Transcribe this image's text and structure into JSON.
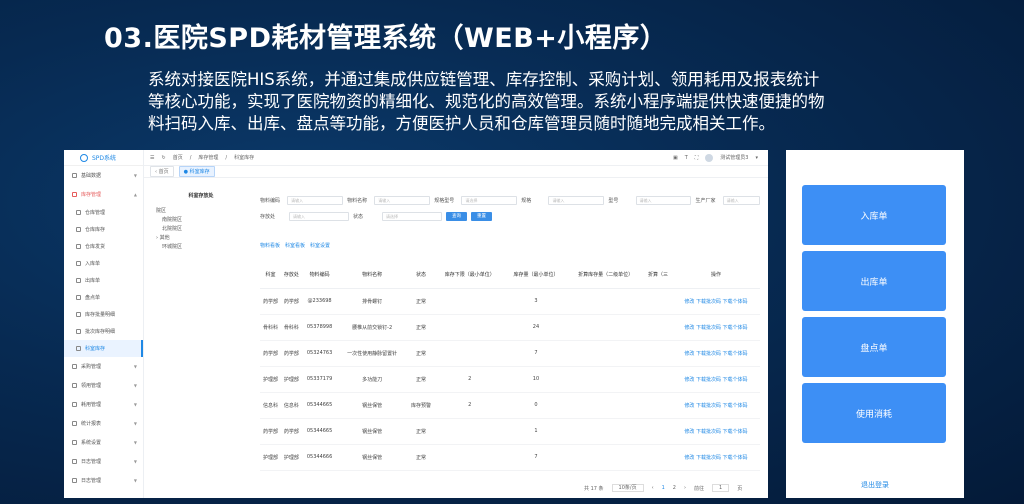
{
  "slide": {
    "title": "03.医院SPD耗材管理系统（WEB+小程序）",
    "desc_lines": [
      "系统对接医院HIS系统，并通过集成供应链管理、库存控制、采购计划、领用耗用及报表统计",
      "等核心功能，实现了医院物资的精细化、规范化的高效管理。系统小程序端提供快速便捷的物",
      "料扫码入库、出库、盘点等功能，方便医护人员和仓库管理员随时随地完成相关工作。"
    ]
  },
  "web": {
    "logo": "SPD系统",
    "menu": [
      "基础数据",
      "库存管理",
      "仓库管理",
      "仓库库存",
      "仓库发货",
      "入库单",
      "出库单",
      "盘点单",
      "库存批量明细",
      "批次库存明细",
      "科室库存",
      "采购管理",
      "领用管理",
      "耗用管理",
      "统计报表",
      "系统设置",
      "日志管理",
      "日志管理"
    ],
    "topbar": {
      "home": "首页",
      "crumb1": "库存管理",
      "crumb2": "科室库存",
      "user": "测试管理员3"
    },
    "tabs": {
      "back": "首页",
      "current": "科室库存"
    },
    "tree": {
      "title": "科室存放处",
      "nodes": [
        "院区",
        "南院院区",
        "北院院区",
        "其他",
        "环城院区"
      ]
    },
    "filters": {
      "row1": [
        {
          "label": "物料编码",
          "ph": "请输入"
        },
        {
          "label": "物料名称",
          "ph": "请输入"
        },
        {
          "label": "规格型号",
          "ph": "请选择"
        },
        {
          "label": "规格",
          "ph": "请输入"
        },
        {
          "label": "型号",
          "ph": "请输入"
        },
        {
          "label": "生产厂家",
          "ph": "请输入"
        }
      ],
      "row2": [
        {
          "label": "存放处",
          "ph": "请输入"
        },
        {
          "label": "状态",
          "ph": "请选择"
        }
      ],
      "search": "查询",
      "reset": "重置",
      "links": [
        "物料看板",
        "科室看板",
        "科室设置"
      ]
    },
    "table": {
      "headers": [
        "",
        "科室",
        "存放处",
        "物料编码",
        "物料名称",
        "状态",
        "库存下限（最小单位）",
        "库存量（最小单位）",
        "折算库存量（二级单位）",
        "折算（三",
        "操作"
      ],
      "rows": [
        [
          "",
          "药学部",
          "药学部",
          "@233698",
          "排骨螺钉",
          "正常",
          "",
          "3",
          "",
          "",
          "修改 下载批次码 下载个体码"
        ],
        [
          "",
          "骨科科",
          "骨科科",
          "05378998",
          "腰椎从前交锁钉-2",
          "正常",
          "",
          "24",
          "",
          "",
          "修改 下载批次码 下载个体码"
        ],
        [
          "",
          "药学部",
          "药学部",
          "05324763",
          "一次性使用静脉留置针",
          "正常",
          "",
          "7",
          "",
          "",
          "修改 下载批次码 下载个体码"
        ],
        [
          "",
          "护理部",
          "护理部",
          "05337179",
          "多功能刀",
          "正常",
          "2",
          "10",
          "",
          "",
          "修改 下载批次码 下载个体码"
        ],
        [
          "",
          "信息科",
          "信息科",
          "05344665",
          "钢丝保管",
          "库存预警",
          "2",
          "0",
          "",
          "",
          "修改 下载批次码 下载个体码"
        ],
        [
          "",
          "药学部",
          "药学部",
          "05344665",
          "钢丝保管",
          "正常",
          "",
          "1",
          "",
          "",
          "修改 下载批次码 下载个体码"
        ],
        [
          "",
          "护理部",
          "护理部",
          "05344666",
          "钢丝保管",
          "正常",
          "",
          "7",
          "",
          "",
          "修改 下载批次码 下载个体码"
        ]
      ]
    },
    "pager": {
      "total": "共 17 条",
      "size": "10条/页",
      "p1": "1",
      "p2": "2",
      "goto": "前往",
      "page": "1",
      "unit": "页"
    }
  },
  "miniapp": {
    "buttons": [
      "入库单",
      "出库单",
      "盘点单",
      "使用消耗"
    ],
    "logout": "退出登录"
  }
}
